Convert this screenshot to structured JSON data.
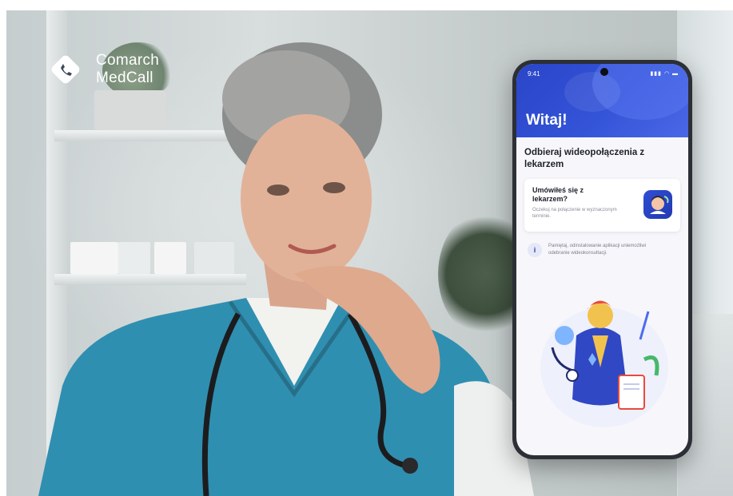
{
  "brand": {
    "name_line1": "Comarch",
    "name_line2": "MedCall"
  },
  "phone": {
    "status_time": "9:41",
    "status_icons": "signal-wifi-battery",
    "greeting": "Witaj!",
    "headline": "Odbieraj wideopołączenia z lekarzem",
    "card": {
      "title": "Umówiłeś się z lekarzem?",
      "description": "Oczekuj na połączenie w wyznaczonym terminie.",
      "icon": "doctor-video-icon"
    },
    "info": {
      "icon": "info-icon",
      "text": "Pamiętaj, odinstalowanie aplikacji uniemożliwi odebranie wideokonsultacji."
    },
    "illustration": "doctor-illustration"
  },
  "colors": {
    "primary_blue": "#3454d8",
    "scrubs": "#2f8fb0",
    "background": "#c5cdce"
  }
}
